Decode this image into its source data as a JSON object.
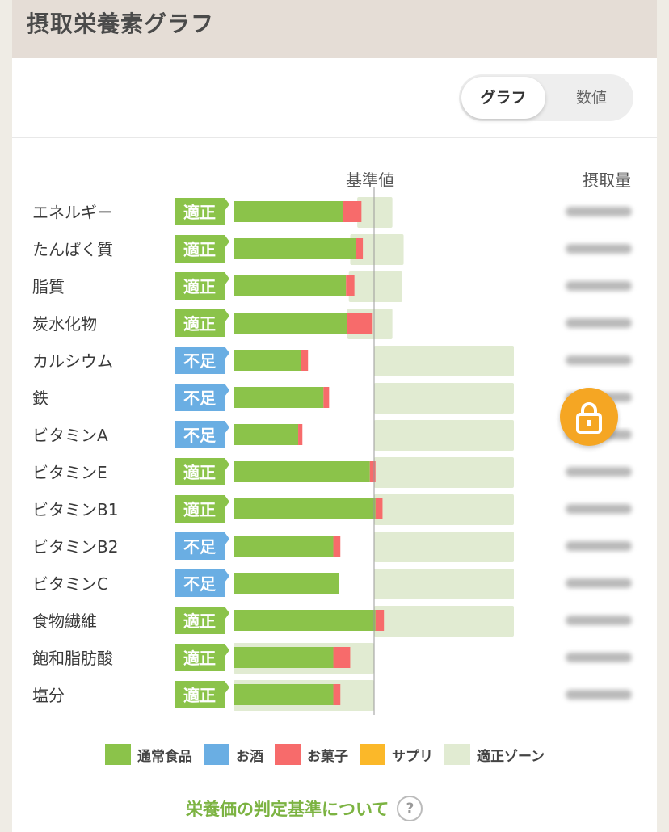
{
  "header": {
    "title": "摂取栄養素グラフ"
  },
  "toggle": {
    "graph_label": "グラフ",
    "value_label": "数値"
  },
  "columns": {
    "reference": "基準値",
    "intake": "摂取量"
  },
  "colors": {
    "normal_food": "#8bc34a",
    "alcohol": "#6aaee3",
    "snack": "#f76b6b",
    "supplement": "#fbb829",
    "zone": "#e1ebd2",
    "status_ok": "#8bc34a",
    "status_low": "#6aaee3"
  },
  "legend": [
    {
      "label": "通常食品",
      "color": "#8bc34a"
    },
    {
      "label": "お酒",
      "color": "#6aaee3"
    },
    {
      "label": "お菓子",
      "color": "#f76b6b"
    },
    {
      "label": "サプリ",
      "color": "#fbb829"
    },
    {
      "label": "適正ゾーン",
      "color": "#e1ebd2"
    }
  ],
  "footer": {
    "link_label": "栄養価の判定基準について",
    "help_symbol": "?"
  },
  "chart_data": {
    "type": "bar",
    "orientation": "horizontal",
    "stacked": true,
    "reference_value": 100,
    "categories": [
      "エネルギー",
      "たんぱく質",
      "脂質",
      "炭水化物",
      "カルシウム",
      "鉄",
      "ビタミンA",
      "ビタミンE",
      "ビタミンB1",
      "ビタミンB2",
      "ビタミンC",
      "食物繊維",
      "飽和脂肪酸",
      "塩分"
    ],
    "status": [
      "適正",
      "適正",
      "適正",
      "適正",
      "不足",
      "不足",
      "不足",
      "適正",
      "適正",
      "不足",
      "不足",
      "適正",
      "適正",
      "適正"
    ],
    "series": [
      {
        "name": "通常食品",
        "values": [
          78,
          87,
          80,
          81,
          48,
          64,
          46,
          97,
          101,
          71,
          75,
          101,
          71,
          71
        ]
      },
      {
        "name": "お菓子",
        "values": [
          13,
          5,
          6,
          18,
          5,
          4,
          3,
          4,
          5,
          5,
          0,
          6,
          12,
          5
        ]
      }
    ],
    "zone": [
      [
        88,
        113
      ],
      [
        83,
        121
      ],
      [
        82,
        120
      ],
      [
        81,
        113
      ],
      [
        100,
        200
      ],
      [
        100,
        200
      ],
      [
        100,
        200
      ],
      [
        100,
        200
      ],
      [
        100,
        200
      ],
      [
        100,
        200
      ],
      [
        100,
        200
      ],
      [
        100,
        200
      ],
      [
        0,
        100
      ],
      [
        0,
        100
      ]
    ]
  }
}
